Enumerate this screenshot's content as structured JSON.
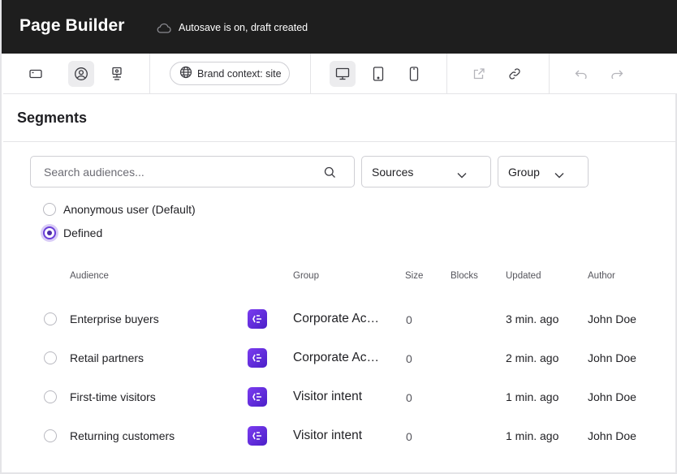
{
  "app": {
    "title": "Page Builder",
    "autosave_text": "Autosave is on, draft created"
  },
  "toolbar": {
    "brand_context": "Brand context: site",
    "icons": [
      "sidebar-icon",
      "user-icon",
      "personalize-icon",
      "globe-icon",
      "desktop-icon",
      "tablet-icon",
      "mobile-icon",
      "external-link-icon",
      "link-icon",
      "undo-icon",
      "redo-icon"
    ]
  },
  "section": {
    "title": "Segments"
  },
  "filters": {
    "search_placeholder": "Search audiences...",
    "sources_label": "Sources",
    "group_label": "Group"
  },
  "mode": {
    "options": [
      {
        "label": "Anonymous user (Default)",
        "selected": false
      },
      {
        "label": "Defined",
        "selected": true
      }
    ]
  },
  "table": {
    "headers": {
      "audience": "Audience",
      "group": "Group",
      "size": "Size",
      "blocks": "Blocks",
      "updated": "Updated",
      "author": "Author"
    },
    "rows": [
      {
        "audience": "Enterprise buyers",
        "group": "Corporate Accounts",
        "size": "0",
        "blocks": "",
        "updated": "3 min. ago",
        "author": "John Doe"
      },
      {
        "audience": "Retail partners",
        "group": "Corporate Accounts",
        "size": "0",
        "blocks": "",
        "updated": "2 min. ago",
        "author": "John Doe"
      },
      {
        "audience": "First-time visitors",
        "group": "Visitor intent",
        "size": "0",
        "blocks": "",
        "updated": "1 min. ago",
        "author": "John Doe"
      },
      {
        "audience": "Returning customers",
        "group": "Visitor intent",
        "size": "0",
        "blocks": "",
        "updated": "1 min. ago",
        "author": "John Doe"
      }
    ]
  },
  "colors": {
    "topbar_bg": "#1e1e1e",
    "accent": "#6a3fd8",
    "group_icon": "#6b2fe6"
  }
}
